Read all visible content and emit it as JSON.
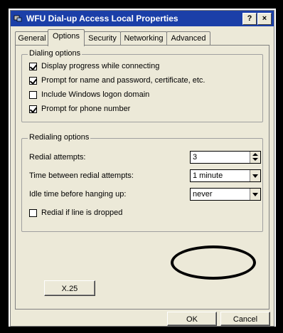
{
  "window": {
    "title": "WFU Dial-up Access Local Properties",
    "help_label": "?",
    "close_label": "×"
  },
  "tabs": [
    {
      "label": "General",
      "active": false
    },
    {
      "label": "Options",
      "active": true
    },
    {
      "label": "Security",
      "active": false
    },
    {
      "label": "Networking",
      "active": false
    },
    {
      "label": "Advanced",
      "active": false
    }
  ],
  "dialing_options": {
    "legend": "Dialing options",
    "items": [
      {
        "label": "Display progress while connecting",
        "checked": true
      },
      {
        "label": "Prompt for name and password, certificate, etc.",
        "checked": true
      },
      {
        "label": "Include Windows logon domain",
        "checked": false
      },
      {
        "label": "Prompt for phone number",
        "checked": true
      }
    ]
  },
  "redialing_options": {
    "legend": "Redialing options",
    "redial_attempts_label": "Redial attempts:",
    "redial_attempts_value": "3",
    "time_between_label": "Time between redial attempts:",
    "time_between_value": "1 minute",
    "idle_time_label": "Idle time before hanging up:",
    "idle_time_value": "never",
    "redial_if_dropped_label": "Redial if line is dropped",
    "redial_if_dropped_checked": false
  },
  "x25_button_label": "X.25",
  "ok_label": "OK",
  "cancel_label": "Cancel",
  "colors": {
    "titlebar": "#1b3fa8",
    "dialog_bg": "#ece9d8"
  }
}
